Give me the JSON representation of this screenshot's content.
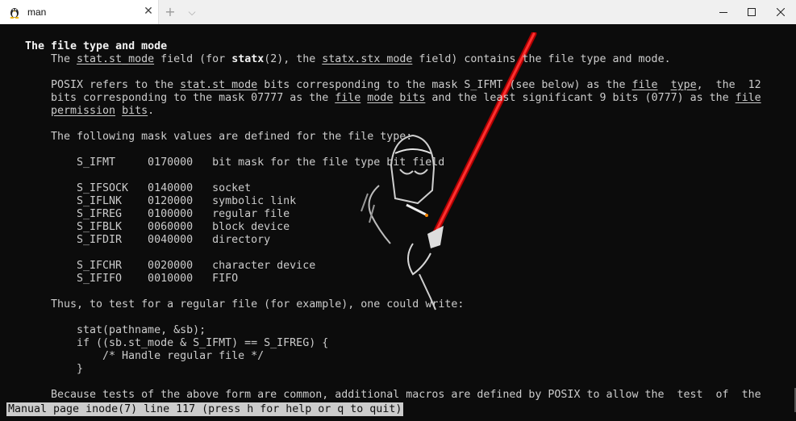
{
  "window": {
    "tab_title": "man",
    "tab_icon": "tux-linux-icon",
    "new_tab_symbol": "+",
    "dropdown_symbol": "⌵",
    "close_tab_symbol": "✕",
    "controls": [
      "minimize-icon",
      "maximize-icon",
      "close-icon"
    ]
  },
  "terminal": {
    "background": "#0c0c0c",
    "text_color": "#cccccc",
    "lines": {
      "l1": "The file type and mode",
      "l2a": "The ",
      "l2b": "stat.st_mode",
      "l2c": " field (for ",
      "l2d": "statx",
      "l2e": "(2), the ",
      "l2f": "statx.stx_mode",
      "l2g": " field) contains the file type and mode.",
      "l3a": "POSIX refers to the ",
      "l3b": "stat.st_mode",
      "l3c": " bits corresponding to the mask S_IFMT (see below) as the ",
      "l3d": "file",
      "l3e": "  ",
      "l3f": "type",
      "l3g": ",  the  12",
      "l4a": "bits corresponding to the mask 07777 as the ",
      "l4b": "file",
      "l4c": " ",
      "l4d": "mode",
      "l4e": " ",
      "l4f": "bits",
      "l4g": " and the least significant 9 bits (0777) as the ",
      "l4h": "file",
      "l5a": "permission",
      "l5b": " ",
      "l5c": "bits",
      "l5d": ".",
      "l6": "The following mask values are defined for the file type:",
      "t1": "S_IFMT     0170000   bit mask for the file type bit field",
      "t2": "S_IFSOCK   0140000   socket",
      "t3": "S_IFLNK    0120000   symbolic link",
      "t4": "S_IFREG    0100000   regular file",
      "t5": "S_IFBLK    0060000   block device",
      "t6": "S_IFDIR    0040000   directory",
      "t7": "S_IFCHR    0020000   character device",
      "t8": "S_IFIFO    0010000   FIFO",
      "l7": "Thus, to test for a regular file (for example), one could write:",
      "c1": "stat(pathname, &sb);",
      "c2": "if ((sb.st_mode & S_IFMT) == S_IFREG) {",
      "c3": "    /* Handle regular file */",
      "c4": "}",
      "l8": "Because tests of the above form are common, additional macros are defined by POSIX to allow the  test  of  the"
    },
    "status": "Manual page inode(7) line 117 (press h for help or q to quit)"
  },
  "background_art": {
    "description_icon": "darth-vader-lightsaber-art",
    "saber_color": "#e01010"
  }
}
